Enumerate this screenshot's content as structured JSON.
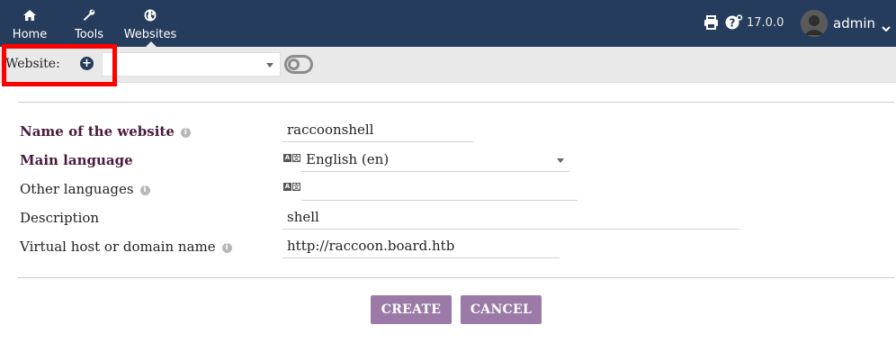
{
  "nav": {
    "home_label": "Home",
    "tools_label": "Tools",
    "websites_label": "Websites"
  },
  "topbar": {
    "version": "17.0.0",
    "username": "admin"
  },
  "website_bar": {
    "label": "Website:",
    "selected_website": ""
  },
  "form": {
    "name_label": "Name of the website",
    "name_value": "raccoonshell",
    "main_language_label": "Main language",
    "main_language_value": "English (en)",
    "other_languages_label": "Other languages",
    "other_languages_value": "",
    "description_label": "Description",
    "description_value": "shell",
    "vhost_label": "Virtual host or domain name",
    "vhost_value": "http://raccoon.board.htb"
  },
  "buttons": {
    "create": "CREATE",
    "cancel": "CANCEL"
  },
  "colors": {
    "topbar": "#263c5c",
    "button": "#9b7aa7",
    "required_label": "#4a1a3e",
    "highlight": "#ff0000"
  },
  "icons": {
    "home": "home-icon",
    "tools": "wrench-icon",
    "websites": "globe-icon",
    "print": "printer-icon",
    "help": "help-icon",
    "add": "plus-circle-icon",
    "info": "info-icon",
    "language": "language-icon"
  }
}
